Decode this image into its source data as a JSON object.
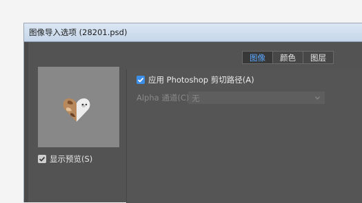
{
  "window": {
    "title": "图像导入选项 (28201.psd)"
  },
  "tabs": [
    {
      "label": "图像",
      "active": true
    },
    {
      "label": "颜色",
      "active": false
    },
    {
      "label": "图层",
      "active": false
    }
  ],
  "preview": {
    "show_preview_label": "显示预览(S)",
    "show_preview_checked": true
  },
  "image_options": {
    "clipping_path_label": "应用 Photoshop 剪切路径(A)",
    "clipping_path_checked": true,
    "alpha_channel_label": "Alpha 通道(C):",
    "alpha_channel_value": "无",
    "alpha_channel_enabled": false
  },
  "colors": {
    "accent": "#3d8ee8",
    "active_tab_text": "#5aa8ff",
    "dialog_bg": "#535353"
  },
  "icons": [
    "check-icon",
    "chevron-down-icon"
  ]
}
